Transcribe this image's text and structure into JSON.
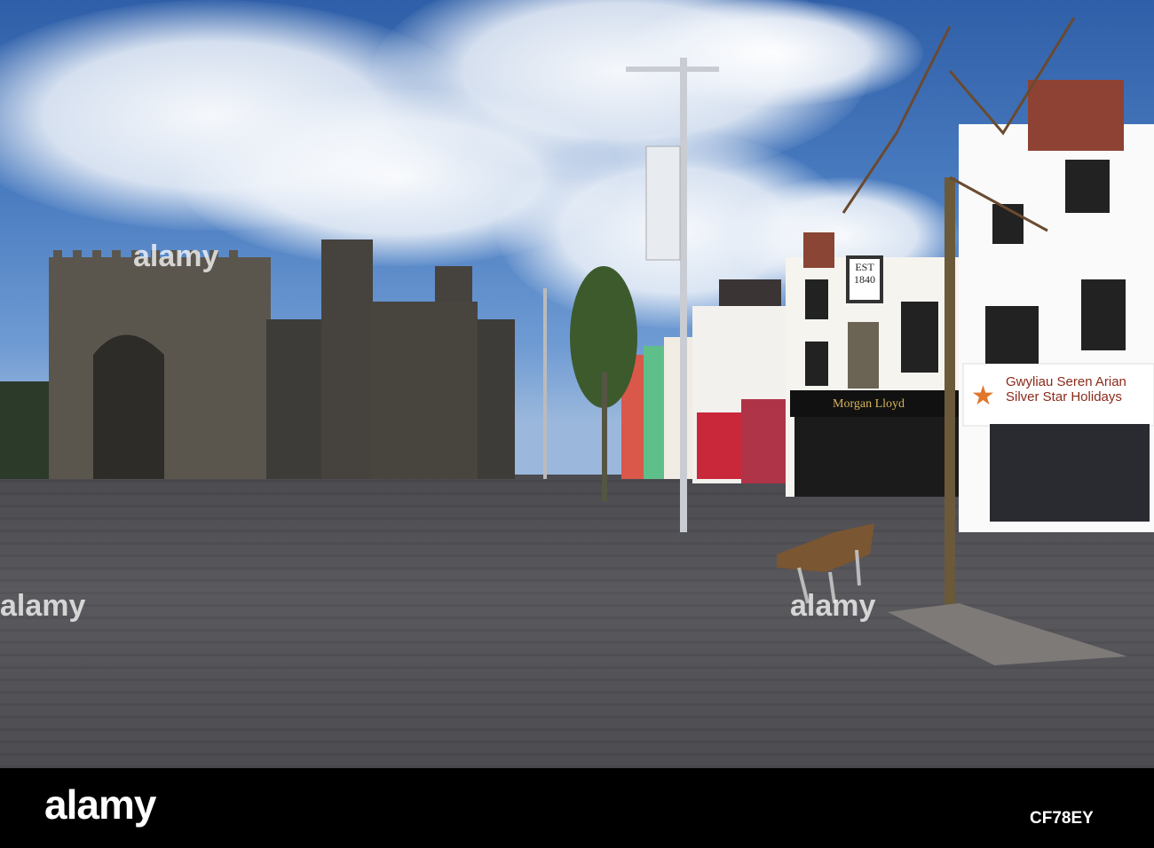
{
  "photo": {
    "description_text": null
  },
  "signs": {
    "est": "EST",
    "year": "1840",
    "pub": "Morgan Lloyd",
    "shop_line1": "Gwyliau Seren Arian",
    "shop_line2": "Silver Star Holidays"
  },
  "watermark": {
    "text": "alamy"
  },
  "footer": {
    "logo": "alamy",
    "image_id": "CF78EY"
  },
  "colors": {
    "sign_text": "#8b2a1a",
    "pub_text": "#d8b45a"
  }
}
